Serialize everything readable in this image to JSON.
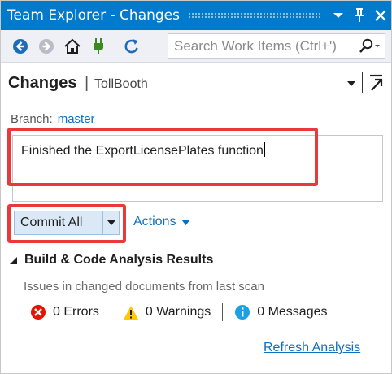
{
  "window": {
    "title": "Team Explorer - Changes"
  },
  "toolbar": {
    "icons": [
      "back-icon",
      "forward-icon",
      "home-icon",
      "connect-icon",
      "refresh-icon"
    ],
    "search_placeholder": "Search Work Items (Ctrl+')"
  },
  "header": {
    "title": "Changes",
    "separator": "|",
    "repo": "TollBooth"
  },
  "branch": {
    "label": "Branch:",
    "name": "master"
  },
  "commit_message": {
    "value": "Finished the ExportLicensePlates function"
  },
  "buttons": {
    "commit_all": "Commit All",
    "actions": "Actions"
  },
  "analysis": {
    "title": "Build & Code Analysis Results",
    "description": "Issues in changed documents from last scan",
    "errors": "0 Errors",
    "warnings": "0 Warnings",
    "messages": "0 Messages",
    "refresh_link": "Refresh Analysis"
  },
  "colors": {
    "titlebar": "#007acc",
    "highlight": "#e83a3a",
    "link": "#0e70c0",
    "error": "#e51400",
    "warning": "#ffc900",
    "info": "#1ba1e2"
  }
}
